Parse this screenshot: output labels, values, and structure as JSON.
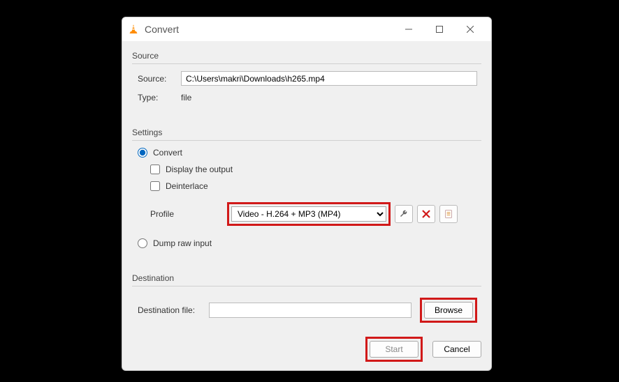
{
  "window": {
    "title": "Convert"
  },
  "source": {
    "group_label": "Source",
    "source_label": "Source:",
    "source_value": "C:\\Users\\makri\\Downloads\\h265.mp4",
    "type_label": "Type:",
    "type_value": "file"
  },
  "settings": {
    "group_label": "Settings",
    "convert_label": "Convert",
    "display_output_label": "Display the output",
    "deinterlace_label": "Deinterlace",
    "profile_label": "Profile",
    "profile_value": "Video - H.264 + MP3 (MP4)",
    "dump_raw_label": "Dump raw input"
  },
  "destination": {
    "group_label": "Destination",
    "file_label": "Destination file:",
    "file_value": "",
    "browse_label": "Browse"
  },
  "actions": {
    "start_label": "Start",
    "cancel_label": "Cancel"
  }
}
